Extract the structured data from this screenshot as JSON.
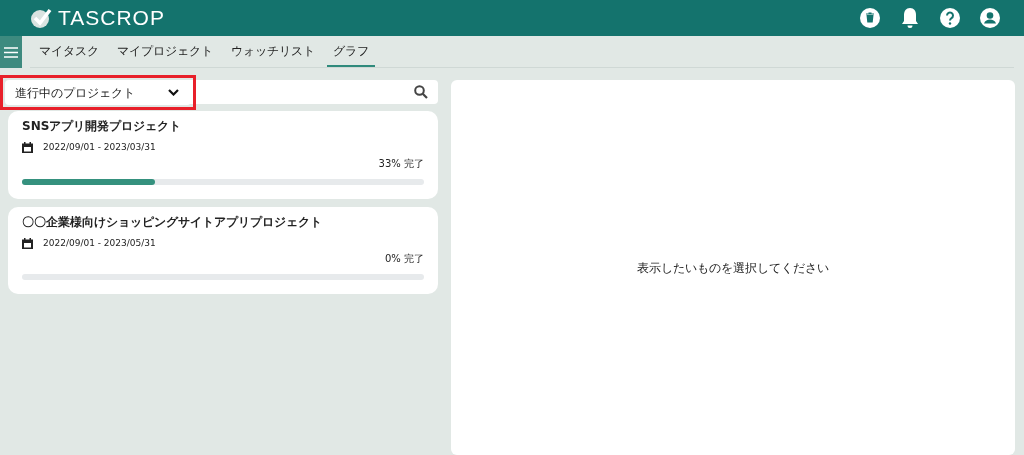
{
  "header": {
    "logo": "TASCROP"
  },
  "tabs": [
    {
      "label": "マイタスク",
      "selected": false
    },
    {
      "label": "マイプロジェクト",
      "selected": false
    },
    {
      "label": "ウォッチリスト",
      "selected": false
    },
    {
      "label": "グラフ",
      "selected": true
    }
  ],
  "filter": {
    "value": "進行中のプロジェクト",
    "highlighted": true
  },
  "projects": [
    {
      "title": "SNSアプリ開発プロジェクト",
      "period": "2022/09/01 - 2023/03/31",
      "progress": "33% 完了",
      "level": 0.33
    },
    {
      "title": "〇〇企業様向けショッピングサイトアプリプロジェクト",
      "period": "2022/09/01 - 2023/05/31",
      "progress": "0% 完了",
      "level": 0
    }
  ],
  "detail": {
    "message": "表示したいものを選択してください"
  }
}
